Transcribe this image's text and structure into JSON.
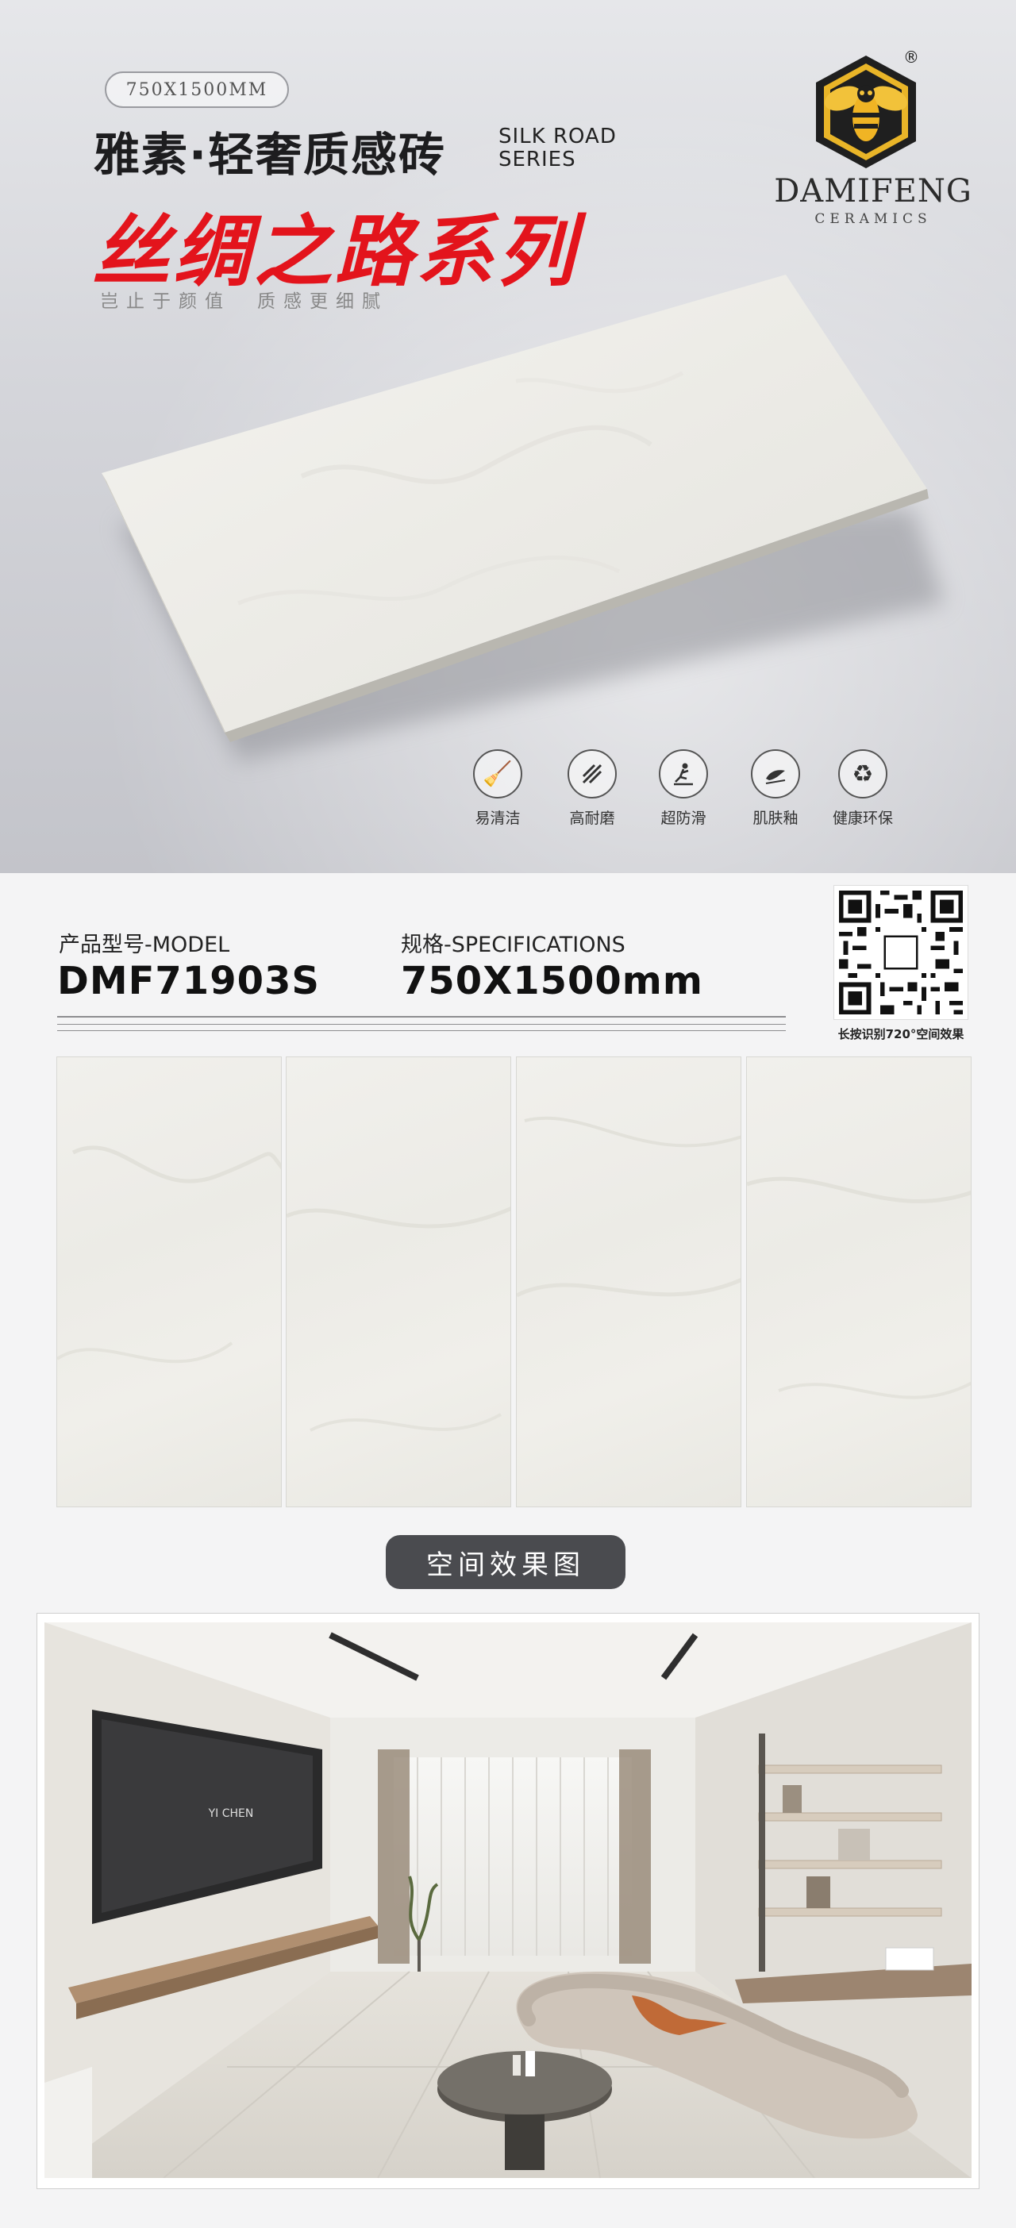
{
  "hero": {
    "size_badge": "750X1500MM",
    "title_cn": "雅素·轻奢质感砖",
    "title_en_line1": "SILK ROAD",
    "title_en_line2": "SERIES",
    "series_name": "丝绸之路系列",
    "slogan": "岂止于颜值　质感更细腻"
  },
  "logo": {
    "brand": "DAMIFENG",
    "subtitle": "CERAMICS",
    "registered_mark": "®",
    "icon": "bee-hexagon-icon"
  },
  "features": [
    {
      "icon": "broom-clean-icon",
      "label": "易清洁"
    },
    {
      "icon": "wear-resistant-icon",
      "label": "高耐磨"
    },
    {
      "icon": "anti-slip-icon",
      "label": "超防滑"
    },
    {
      "icon": "skin-glaze-icon",
      "label": "肌肤釉"
    },
    {
      "icon": "recycle-icon",
      "label": "健康环保"
    }
  ],
  "product": {
    "model_label": "产品型号-MODEL",
    "model_value": "DMF71903S",
    "spec_label": "规格-SPECIFICATIONS",
    "spec_value": "750X1500mm"
  },
  "qr": {
    "caption": "长按识别720°空间效果"
  },
  "panels_count": 4,
  "gallery_button": "空间效果图",
  "room": {
    "tv_text": "YI CHEN"
  },
  "colors": {
    "accent_red": "#e3141c",
    "button_dark": "#4a4b4f",
    "tile": "#efeee9"
  }
}
